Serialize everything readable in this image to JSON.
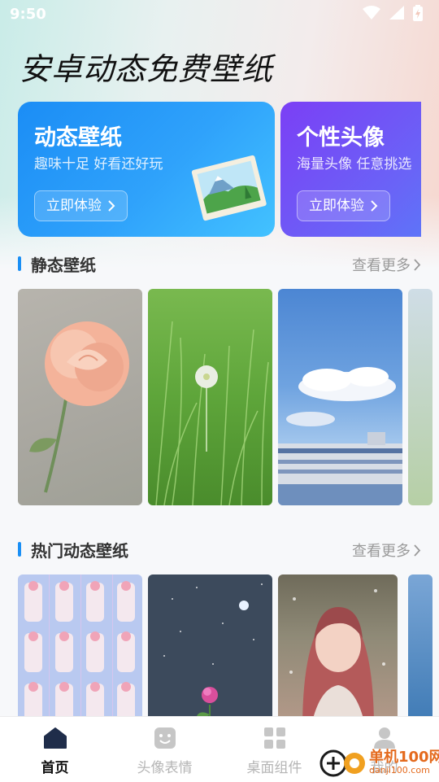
{
  "status": {
    "time": "9:50"
  },
  "app_title": "安卓动态免费壁纸",
  "banners": [
    {
      "title": "动态壁纸",
      "subtitle": "趣味十足 好看还好玩",
      "button": "立即体验"
    },
    {
      "title": "个性头像",
      "subtitle": "海量头像 任意挑选",
      "button": "立即体验"
    }
  ],
  "sections": {
    "static": {
      "title": "静态壁纸",
      "more": "查看更多"
    },
    "hot": {
      "title": "热门动态壁纸",
      "more": "查看更多"
    }
  },
  "tabs": [
    {
      "label": "首页",
      "icon": "home-icon",
      "active": true
    },
    {
      "label": "头像表情",
      "icon": "face-icon",
      "active": false
    },
    {
      "label": "桌面组件",
      "icon": "grid-icon",
      "active": false
    },
    {
      "label": "我的",
      "icon": "user-icon",
      "active": false
    }
  ],
  "watermark": {
    "text": "单机100网",
    "url": "danji100.com"
  },
  "colors": {
    "accent": "#1a8ff5",
    "banner1": "#1b8df5",
    "banner2": "#7b3ff5"
  }
}
